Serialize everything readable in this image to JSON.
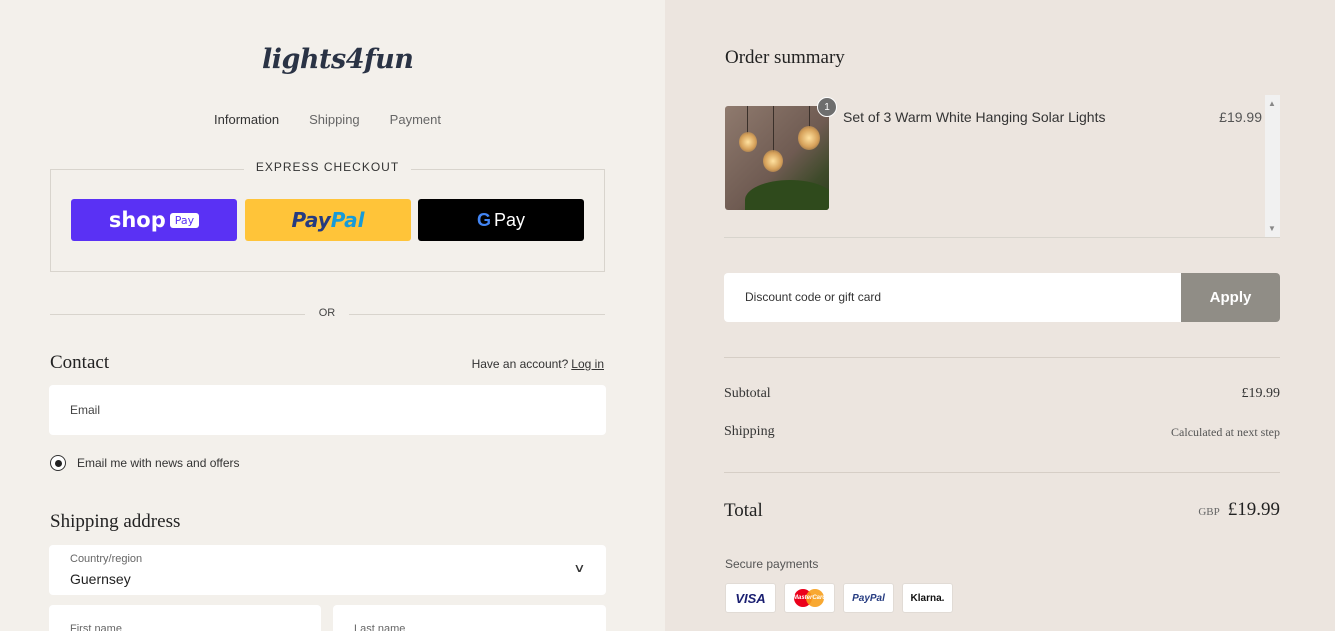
{
  "brand": {
    "logo_text": "lights4fun"
  },
  "breadcrumb": [
    "Information",
    "Shipping",
    "Payment"
  ],
  "express": {
    "title": "EXPRESS CHECKOUT",
    "shop_pay": {
      "shop": "shop",
      "pay": "Pay"
    },
    "paypal": {
      "p1": "Pay",
      "p2": "Pal"
    },
    "gpay": {
      "g": "G",
      "pay": "Pay"
    }
  },
  "divider": "OR",
  "contact": {
    "heading": "Contact",
    "account_prompt": "Have an account?",
    "login_link": "Log in",
    "email_placeholder": "Email",
    "newsletter_label": "Email me with news and offers"
  },
  "shipping": {
    "heading": "Shipping address",
    "country_label": "Country/region",
    "country_value": "Guernsey",
    "first_name_placeholder": "First name",
    "last_name_placeholder": "Last name"
  },
  "summary": {
    "heading": "Order summary",
    "item": {
      "quantity": "1",
      "name": "Set of 3 Warm White Hanging Solar Lights",
      "price": "£19.99"
    },
    "discount_placeholder": "Discount code or gift card",
    "apply_label": "Apply",
    "subtotal_label": "Subtotal",
    "subtotal_value": "£19.99",
    "shipping_label": "Shipping",
    "shipping_value": "Calculated at next step",
    "total_label": "Total",
    "currency": "GBP",
    "total_value": "£19.99",
    "secure_label": "Secure payments",
    "cards": [
      "VISA",
      "MasterCard",
      "PayPal",
      "Klarna."
    ]
  },
  "colors": {
    "shop_pay": "#5a31f4",
    "paypal": "#ffc439",
    "gpay": "#000000",
    "apply": "#908d86"
  }
}
